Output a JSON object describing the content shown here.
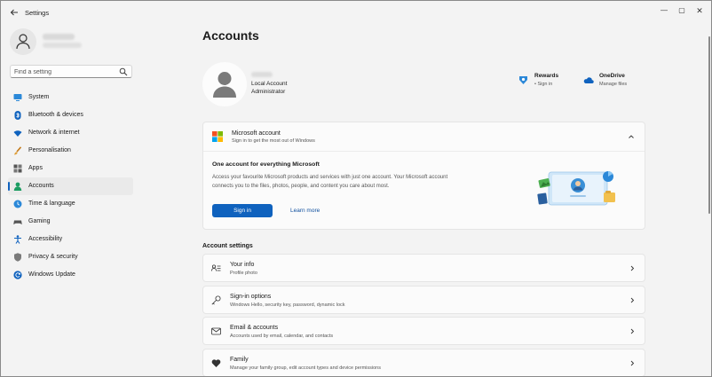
{
  "window": {
    "title": "Settings",
    "minimize": "—",
    "maximize": "▢",
    "close": "✕"
  },
  "sidebar": {
    "search_placeholder": "Find a setting",
    "items": [
      {
        "label": "System",
        "icon": "system-icon",
        "color": "#0f62be"
      },
      {
        "label": "Bluetooth & devices",
        "icon": "bluetooth-icon",
        "color": "#0f62be"
      },
      {
        "label": "Network & internet",
        "icon": "wifi-icon",
        "color": "#0f62be"
      },
      {
        "label": "Personalisation",
        "icon": "brush-icon",
        "color": "#c47a1b"
      },
      {
        "label": "Apps",
        "icon": "apps-icon",
        "color": "#555555"
      },
      {
        "label": "Accounts",
        "icon": "person-icon",
        "color": "#1c9d62",
        "active": true
      },
      {
        "label": "Time & language",
        "icon": "globe-clock-icon",
        "color": "#2b88d8"
      },
      {
        "label": "Gaming",
        "icon": "gamepad-icon",
        "color": "#555555"
      },
      {
        "label": "Accessibility",
        "icon": "accessibility-icon",
        "color": "#0f62be"
      },
      {
        "label": "Privacy & security",
        "icon": "shield-icon",
        "color": "#6b6b6b"
      },
      {
        "label": "Windows Update",
        "icon": "update-icon",
        "color": "#0f62be"
      }
    ]
  },
  "main": {
    "title": "Accounts",
    "account": {
      "type": "Local Account",
      "role": "Administrator"
    },
    "services": {
      "rewards": {
        "title": "Rewards",
        "sub": "• Sign in"
      },
      "onedrive": {
        "title": "OneDrive",
        "sub": "Manage files"
      }
    },
    "microsoft_account": {
      "title": "Microsoft account",
      "subtitle": "Sign in to get the most out of Windows",
      "heading": "One account for everything Microsoft",
      "body_line1": "Access your favourite Microsoft products and services with just one account. Your Microsoft account",
      "body_line2": "connects you to the files, photos, people, and content you care about most.",
      "signin_label": "Sign in",
      "learn_more": "Learn more"
    },
    "account_settings_title": "Account settings",
    "rows": [
      {
        "title": "Your info",
        "sub": "Profile photo",
        "icon": "id-card-icon"
      },
      {
        "title": "Sign-in options",
        "sub": "Windows Hello, security key, password, dynamic lock",
        "icon": "key-icon"
      },
      {
        "title": "Email & accounts",
        "sub": "Accounts used by email, calendar, and contacts",
        "icon": "mail-icon"
      },
      {
        "title": "Family",
        "sub": "Manage your family group, edit account types and device permissions",
        "icon": "heart-icon"
      }
    ]
  },
  "colors": {
    "accent": "#0f62be",
    "background": "#f3f3f3",
    "card": "#fbfbfb"
  }
}
